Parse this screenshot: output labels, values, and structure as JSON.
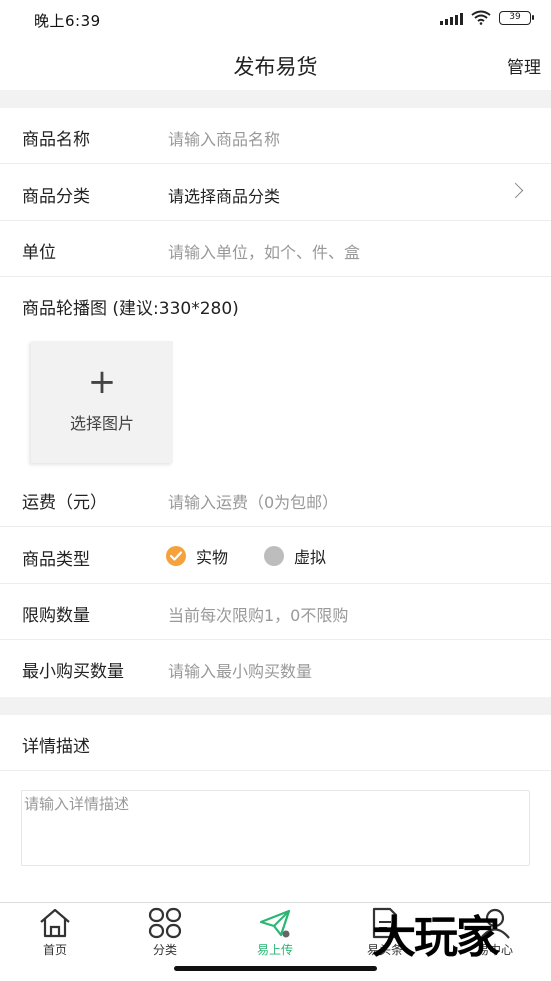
{
  "status_bar": {
    "time": "晚上6:39",
    "battery": "39"
  },
  "nav": {
    "title": "发布易货",
    "action": "管理"
  },
  "form": {
    "name": {
      "label": "商品名称",
      "placeholder": "请输入商品名称"
    },
    "category": {
      "label": "商品分类",
      "value": "请选择商品分类"
    },
    "unit": {
      "label": "单位",
      "placeholder": "请输入单位，如个、件、盒"
    },
    "carousel": {
      "label": "商品轮播图 (建议:330*280)",
      "upload_plus": "+",
      "upload_label": "选择图片"
    },
    "shipping": {
      "label": "运费（元）",
      "placeholder": "请输入运费（0为包邮）"
    },
    "type": {
      "label": "商品类型",
      "options": [
        {
          "label": "实物",
          "selected": true
        },
        {
          "label": "虚拟",
          "selected": false
        }
      ]
    },
    "limit": {
      "label": "限购数量",
      "placeholder": "当前每次限购1，0不限购"
    },
    "min_qty": {
      "label": "最小购买数量",
      "placeholder": "请输入最小购买数量"
    },
    "description": {
      "label": "详情描述",
      "placeholder": "请输入详情描述"
    }
  },
  "tab_bar": {
    "tabs": [
      {
        "label": "首页",
        "icon": "home-icon",
        "active": false
      },
      {
        "label": "分类",
        "icon": "category-grid-icon",
        "active": false
      },
      {
        "label": "易上传",
        "icon": "paper-plane-icon",
        "active": true
      },
      {
        "label": "易头条",
        "icon": "document-icon",
        "active": false
      },
      {
        "label": "易中心",
        "icon": "user-icon",
        "active": false
      }
    ]
  },
  "watermark": "大玩家",
  "colors": {
    "accent_orange": "#f5a23c",
    "active_green": "#2bb673",
    "placeholder": "#999999",
    "separator": "#f2f2f2"
  }
}
